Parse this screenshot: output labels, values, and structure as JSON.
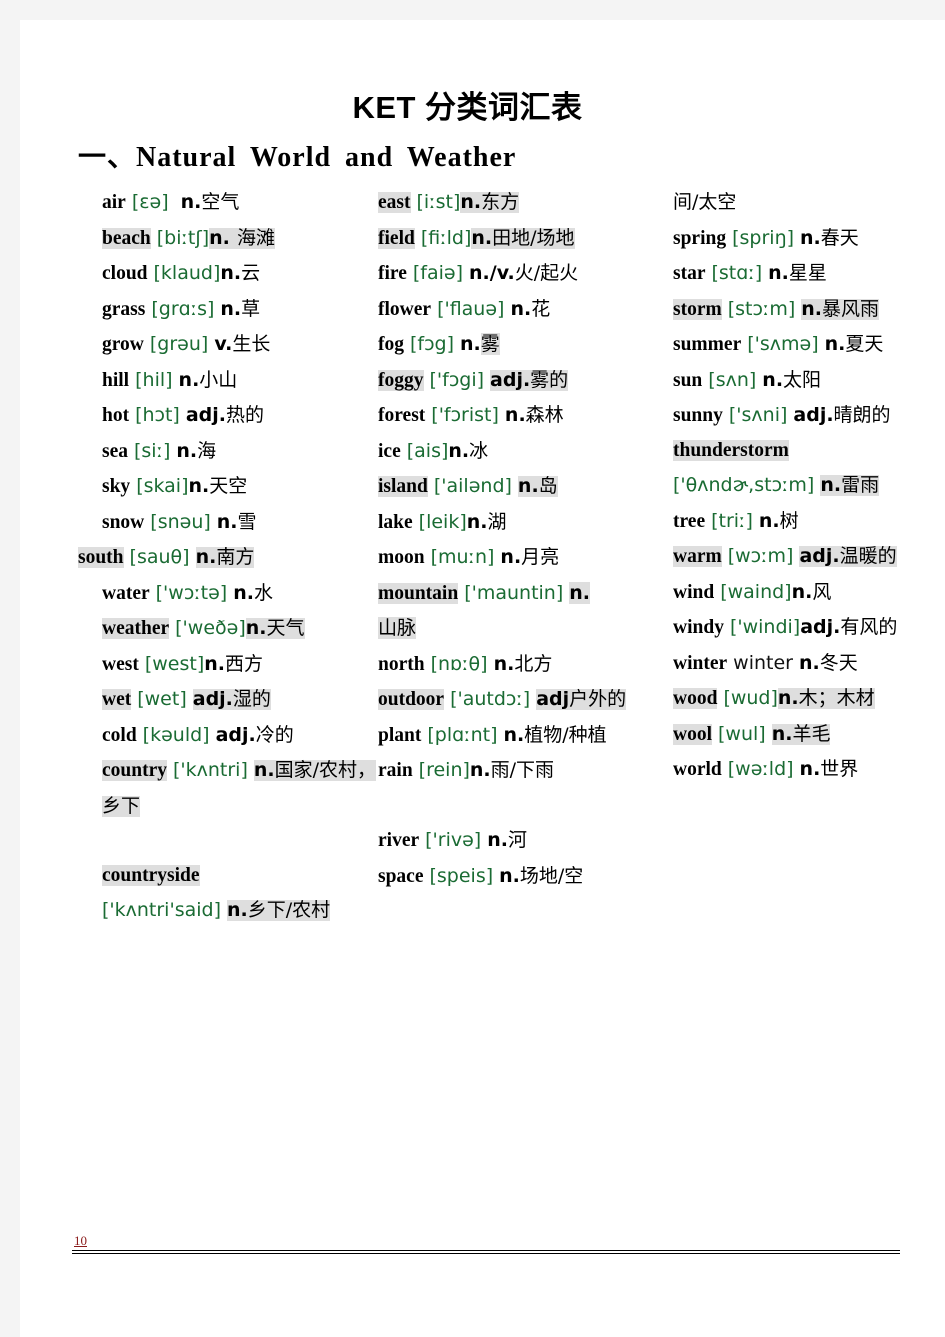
{
  "document": {
    "title": "KET 分类词汇表",
    "section_heading": "一、Natural World and Weather",
    "page_number": "10"
  },
  "colors": {
    "phonetic_green": "#1a6b33",
    "highlight_gray": "#dedede",
    "page_number_red": "#8a1a1a"
  },
  "columns": [
    {
      "name": "column-1",
      "entries": [
        {
          "word": "air",
          "phonetic": "[ɛə]",
          "pos": "n.",
          "meaning": "空气"
        },
        {
          "word": "beach",
          "phonetic": "[biːtʃ]",
          "pos": "n.",
          "meaning": " 海滩"
        },
        {
          "word": "cloud",
          "phonetic": "[klaud]",
          "pos": "n.",
          "meaning": "云"
        },
        {
          "word": "grass",
          "phonetic": "[grɑːs]",
          "pos": "n.",
          "meaning": "草"
        },
        {
          "word": "grow",
          "phonetic": "[grəu]",
          "pos": "v.",
          "meaning": "生长"
        },
        {
          "word": "hill",
          "phonetic": "[hil]",
          "pos": "n.",
          "meaning": "小山"
        },
        {
          "word": "hot",
          "phonetic": "[hɔt]",
          "pos": "adj.",
          "meaning": "热的"
        },
        {
          "word": "sea",
          "phonetic": "[siː]",
          "pos": "n.",
          "meaning": "海"
        },
        {
          "word": "sky",
          "phonetic": "[skai]",
          "pos": "n.",
          "meaning": "天空"
        },
        {
          "word": "snow",
          "phonetic": "[snəu]",
          "pos": "n.",
          "meaning": "雪"
        },
        {
          "word": "south",
          "phonetic": "[sauθ]",
          "pos": "n.",
          "meaning": "南方"
        },
        {
          "word": "water",
          "phonetic": "['wɔːtə]",
          "pos": "n.",
          "meaning": "水"
        },
        {
          "word": "weather",
          "phonetic": "['weðə]",
          "pos": "n.",
          "meaning": "天气"
        },
        {
          "word": "west",
          "phonetic": "[west]",
          "pos": "n.",
          "meaning": "西方"
        },
        {
          "word": "wet",
          "phonetic": "[wet]",
          "pos": "adj.",
          "meaning": "湿的"
        },
        {
          "word": "cold",
          "phonetic": "[kəuld]",
          "pos": "adj.",
          "meaning": "冷的"
        },
        {
          "word": "country",
          "phonetic": "['kʌntri]",
          "pos": "n.",
          "meaning": "国家/农村，乡下"
        },
        {
          "word": "countryside",
          "phonetic": "['kʌntri'said]",
          "pos": "n.",
          "meaning": "乡下/农村"
        }
      ]
    },
    {
      "name": "column-2",
      "entries": [
        {
          "word": "east",
          "phonetic": "[iːst]",
          "pos": "n.",
          "meaning": "东方"
        },
        {
          "word": "field",
          "phonetic": "[fiːld]",
          "pos": "n.",
          "meaning": "田地/场地"
        },
        {
          "word": "fire",
          "phonetic": "[faiə]",
          "pos": "n./v.",
          "meaning": "火/起火"
        },
        {
          "word": "flower",
          "phonetic": "['flauə]",
          "pos": "n.",
          "meaning": "花"
        },
        {
          "word": "fog",
          "phonetic": "[fɔg]",
          "pos": "n.",
          "meaning": "雾"
        },
        {
          "word": "foggy",
          "phonetic": "['fɔgi]",
          "pos": "adj.",
          "meaning": "雾的"
        },
        {
          "word": "forest",
          "phonetic": "['fɔrist]",
          "pos": "n.",
          "meaning": "森林"
        },
        {
          "word": "ice",
          "phonetic": "[ais]",
          "pos": "n.",
          "meaning": "冰"
        },
        {
          "word": "island",
          "phonetic": "['ailənd]",
          "pos": "n.",
          "meaning": "岛"
        },
        {
          "word": "lake",
          "phonetic": "[leik]",
          "pos": "n.",
          "meaning": "湖"
        },
        {
          "word": "moon",
          "phonetic": "[muːn]",
          "pos": "n.",
          "meaning": "月亮"
        },
        {
          "word": "mountain",
          "phonetic": "['mauntin]",
          "pos": "n.",
          "meaning": "山脉"
        },
        {
          "word": "north",
          "phonetic": "[nɒːθ]",
          "pos": "n.",
          "meaning": "北方"
        },
        {
          "word": "outdoor",
          "phonetic": "['autdɔː]",
          "pos": "adj",
          "meaning": "户外的"
        },
        {
          "word": "plant",
          "phonetic": "[plɑːnt]",
          "pos": "n.",
          "meaning": "植物/种植"
        },
        {
          "word": "rain",
          "phonetic": "[rein]",
          "pos": "n.",
          "meaning": "雨/下雨"
        },
        {
          "word": "river",
          "phonetic": "['rivə]",
          "pos": "n.",
          "meaning": "河"
        },
        {
          "word": "space",
          "phonetic": "[speis]",
          "pos": "n.",
          "meaning": "场地/空"
        }
      ]
    },
    {
      "name": "column-3",
      "carryover": "间/太空",
      "entries": [
        {
          "word": "spring",
          "phonetic": "[spriŋ]",
          "pos": "n.",
          "meaning": "春天"
        },
        {
          "word": "star",
          "phonetic": "[stɑː]",
          "pos": "n.",
          "meaning": "星星"
        },
        {
          "word": "storm",
          "phonetic": "[stɔːm]",
          "pos": "n.",
          "meaning": "暴风雨"
        },
        {
          "word": "summer",
          "phonetic": "['sʌmə]",
          "pos": "n.",
          "meaning": "夏天"
        },
        {
          "word": "sun",
          "phonetic": "[sʌn]",
          "pos": "n.",
          "meaning": "太阳"
        },
        {
          "word": "sunny",
          "phonetic": "['sʌni]",
          "pos": "adj.",
          "meaning": "晴朗的"
        },
        {
          "word": "thunderstorm",
          "phonetic": "['θʌndɚ,stɔːm]",
          "pos": "n.",
          "meaning": "雷雨"
        },
        {
          "word": "tree",
          "phonetic": "[triː]",
          "pos": "n.",
          "meaning": "树"
        },
        {
          "word": "warm",
          "phonetic": "[wɔːm]",
          "pos": "adj.",
          "meaning": "温暖的"
        },
        {
          "word": "wind",
          "phonetic": "[waind]",
          "pos": "n.",
          "meaning": "风"
        },
        {
          "word": "windy",
          "phonetic": "['windi]",
          "pos": "adj.",
          "meaning": "有风的"
        },
        {
          "word": "winter",
          "phonetic": "winter",
          "pos": "n.",
          "meaning": "冬天"
        },
        {
          "word": "wood",
          "phonetic": "[wud]",
          "pos": "n.",
          "meaning": "木；木材"
        },
        {
          "word": "wool",
          "phonetic": "[wul]",
          "pos": "n.",
          "meaning": "羊毛"
        },
        {
          "word": "world",
          "phonetic": "[wəːld]",
          "pos": "n.",
          "meaning": "世界"
        }
      ]
    }
  ]
}
